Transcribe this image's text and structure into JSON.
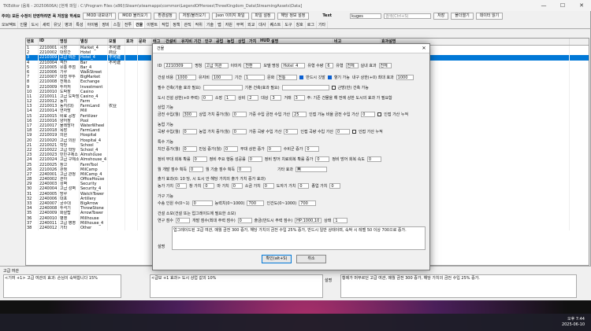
{
  "window": {
    "title": "TKEditor (음복 - 20250606A) [현재 파일 : C:\\Program Files (x86)\\Steam\\steamapps\\common\\LegendOfHeroes\\ThreeKingdom_Data\\StreamingAssets\\Data]",
    "min": "—",
    "max": "☐",
    "close": "✕"
  },
  "toolbar": {
    "items": [
      "주의) 모든 수정이 반영하려면 꼭 저장을 하세요",
      "MOD 내보내기",
      "MOD 불러오기",
      "환경설정",
      "저장/불러오기",
      "Json 이미지 파일",
      "파일 설정",
      "해당 정보 설정"
    ],
    "text_label": "Text",
    "lang": "kuges",
    "search_placeholder": "검색(Ctrl+S)",
    "right_btns": [
      "저장",
      "폴더열기",
      "데이터 읽기",
      "데이터 다시읽기"
    ]
  },
  "tabs": [
    "오브젝트",
    "인물",
    "도시",
    "세력",
    "유닛",
    "병과",
    "특성",
    "아이템",
    "장비",
    "스킬",
    "전투",
    "건물",
    "이벤트",
    "작업",
    "정책",
    "관직",
    "작위",
    "기술",
    "맵",
    "자원",
    "무역",
    "외교",
    "대사",
    "퀘스트",
    "도구",
    "칭호",
    "로그",
    "기타"
  ],
  "grid": {
    "columns": [
      "번호",
      "ID",
      "명칭",
      "별칭",
      "모델",
      "효과",
      "문화",
      "태그",
      "건설비",
      "유지비",
      "기간",
      "인구",
      "공업",
      "농업",
      "상업",
      "가치",
      "HUD",
      "설명",
      "비고",
      "효과설명"
    ],
    "rows": [
      [
        "1",
        "2210001",
        "시장",
        "Market_4",
        "不可建",
        "",
        "",
        "",
        "",
        "",
        "",
        "",
        "",
        "",
        "",
        "",
        "",
        "",
        "",
        "<총 효과 400>"
      ],
      [
        "2",
        "2210002",
        "대장간",
        "Hotel",
        "商业",
        "",
        "",
        "",
        "",
        "",
        "",
        "",
        "",
        "",
        "",
        "",
        "",
        "",
        "",
        ""
      ],
      [
        "3",
        "2210309",
        "고급 여관",
        "Hotel_4",
        "不可建",
        "",
        "",
        "",
        "",
        "",
        "",
        "",
        "",
        "",
        "",
        "",
        "",
        "",
        "",
        "<황혜1기 +1의 효과:15%>"
      ],
      [
        "4",
        "2210004",
        "객잔",
        "Bar",
        "不可建",
        "",
        "",
        "",
        "",
        "",
        "",
        "",
        "",
        "",
        "",
        "",
        "",
        "",
        "",
        ""
      ],
      [
        "5",
        "2210005",
        "유흥 주점",
        "Bar_4",
        "",
        "",
        "",
        "",
        "",
        "",
        "",
        "",
        "",
        "",
        "",
        "",
        "",
        "",
        "",
        "<황혜1기>"
      ],
      [
        "6",
        "2210006",
        "기루",
        "WalkStreet",
        "",
        "",
        "",
        "",
        "",
        "",
        "",
        "",
        "",
        "",
        "",
        "",
        "",
        "",
        "",
        ""
      ],
      [
        "7",
        "2210007",
        "대형 부두",
        "BigMarket",
        "",
        "",
        "",
        "",
        "",
        "",
        "",
        "",
        "",
        "",
        "",
        "",
        "",
        "",
        "",
        "<황혜1기>"
      ],
      [
        "8",
        "2210008",
        "전매소",
        "Exchange",
        "",
        "",
        "",
        "",
        "",
        "",
        "",
        "",
        "",
        "",
        "",
        "",
        "",
        "",
        "",
        "<황혜1기>"
      ],
      [
        "9",
        "2210009",
        "투자처",
        "Investment",
        "",
        "",
        "",
        "",
        "",
        "",
        "",
        "",
        "",
        "",
        "",
        "",
        "",
        "",
        "",
        ""
      ],
      [
        "10",
        "2210010",
        "도박장",
        "Casino",
        "",
        "",
        "",
        "",
        "",
        "",
        "",
        "",
        "",
        "",
        "",
        "",
        "",
        "",
        "",
        ""
      ],
      [
        "11",
        "2210011",
        "고급 도박장",
        "Casino_4",
        "",
        "",
        "",
        "",
        "",
        "",
        "",
        "",
        "",
        "",
        "",
        "",
        "",
        "",
        "",
        "<황혜1기>"
      ],
      [
        "12",
        "2210012",
        "농지",
        "Farm",
        "",
        "",
        "",
        "",
        "",
        "",
        "",
        "",
        "",
        "",
        "",
        "",
        "",
        "",
        "",
        ""
      ],
      [
        "13",
        "2210013",
        "농지(대)",
        "FarmLand",
        "农业",
        "",
        "",
        "",
        "",
        "",
        "",
        "",
        "",
        "",
        "",
        "",
        "",
        "",
        "",
        ""
      ],
      [
        "14",
        "2210014",
        "연자방",
        "Mill",
        "",
        "",
        "",
        "",
        "",
        "",
        "",
        "",
        "",
        "",
        "",
        "",
        "",
        "",
        "",
        ""
      ],
      [
        "15",
        "2210015",
        "비료 공장",
        "Fertilizer",
        "",
        "",
        "",
        "",
        "",
        "",
        "",
        "",
        "",
        "",
        "",
        "",
        "",
        "",
        "",
        "<황혜1기>"
      ],
      [
        "16",
        "2210016",
        "양어장",
        "Pool",
        "",
        "",
        "",
        "",
        "",
        "",
        "",
        "",
        "",
        "",
        "",
        "",
        "",
        "",
        "",
        ""
      ],
      [
        "17",
        "2210017",
        "물레방아",
        "WaterWheel",
        "",
        "",
        "",
        "",
        "",
        "",
        "",
        "",
        "",
        "",
        "",
        "",
        "",
        "",
        "",
        ""
      ],
      [
        "18",
        "2210018",
        "목장",
        "FarmLand",
        "",
        "",
        "",
        "",
        "",
        "",
        "",
        "",
        "",
        "",
        "",
        "",
        "",
        "",
        "",
        ""
      ],
      [
        "19",
        "2210019",
        "의원",
        "Hospital",
        "",
        "",
        "",
        "",
        "",
        "",
        "",
        "",
        "",
        "",
        "",
        "",
        "",
        "",
        "",
        ""
      ],
      [
        "20",
        "2210020",
        "고급 의원",
        "Hospital_4",
        "",
        "",
        "",
        "",
        "",
        "",
        "",
        "",
        "",
        "",
        "",
        "",
        "",
        "",
        "",
        "<황혜1기>"
      ],
      [
        "21",
        "2210021",
        "학당",
        "School",
        "",
        "",
        "",
        "",
        "",
        "",
        "",
        "",
        "",
        "",
        "",
        "",
        "",
        "",
        "",
        ""
      ],
      [
        "22",
        "2210022",
        "고급 학당",
        "School_4",
        "",
        "",
        "",
        "",
        "",
        "",
        "",
        "",
        "",
        "",
        "",
        "",
        "",
        "",
        "",
        ""
      ],
      [
        "23",
        "2210023",
        "빈민구제소",
        "Almshouse",
        "",
        "",
        "",
        "",
        "",
        "",
        "",
        "",
        "",
        "",
        "",
        "",
        "",
        "",
        "",
        ""
      ],
      [
        "24",
        "2210024",
        "고급 구제소",
        "Almshouse_4",
        "",
        "",
        "",
        "",
        "",
        "",
        "",
        "",
        "",
        "",
        "",
        "",
        "",
        "",
        "",
        ""
      ],
      [
        "25",
        "2210025",
        "창고",
        "FarmTool",
        "",
        "",
        "",
        "",
        "",
        "",
        "",
        "",
        "",
        "",
        "",
        "",
        "",
        "",
        "",
        ""
      ],
      [
        "26",
        "2210026",
        "관청",
        "MilCamp",
        "",
        "",
        "",
        "",
        "",
        "",
        "",
        "",
        "",
        "",
        "",
        "",
        "",
        "",
        "",
        ""
      ],
      [
        "27",
        "2240001",
        "고급 관청",
        "MilCamp_4",
        "",
        "",
        "",
        "",
        "",
        "",
        "",
        "",
        "",
        "",
        "",
        "",
        "",
        "",
        "",
        ""
      ],
      [
        "28",
        "2240002",
        "관아",
        "OfficeHouse",
        "",
        "",
        "",
        "",
        "",
        "",
        "",
        "",
        "",
        "",
        "",
        "",
        "",
        "",
        "",
        ""
      ],
      [
        "29",
        "2240003",
        "성벽",
        "Security",
        "",
        "",
        "",
        "",
        "",
        "",
        "",
        "",
        "",
        "",
        "",
        "",
        "",
        "",
        "",
        ""
      ],
      [
        "30",
        "2240004",
        "고급 성벽",
        "Security_4",
        "",
        "",
        "",
        "",
        "",
        "",
        "",
        "",
        "",
        "",
        "",
        "",
        "",
        "",
        "",
        ""
      ],
      [
        "31",
        "2240005",
        "망루",
        "WatchTower",
        "",
        "",
        "",
        "",
        "",
        "",
        "",
        "",
        "",
        "",
        "",
        "",
        "",
        "",
        "",
        ""
      ],
      [
        "32",
        "2240006",
        "대포",
        "Artillery",
        "",
        "",
        "",
        "",
        "",
        "",
        "",
        "",
        "",
        "",
        "",
        "",
        "",
        "",
        "",
        ""
      ],
      [
        "33",
        "2240007",
        "궁수대",
        "BigArrow",
        "",
        "",
        "",
        "",
        "",
        "",
        "",
        "",
        "",
        "",
        "",
        "",
        "",
        "",
        "",
        ""
      ],
      [
        "34",
        "2240008",
        "투석기",
        "ThrowStone",
        "",
        "",
        "",
        "",
        "",
        "",
        "",
        "",
        "",
        "",
        "",
        "",
        "",
        "",
        "",
        ""
      ],
      [
        "35",
        "2240009",
        "화살탑",
        "ArrowTower",
        "",
        "",
        "",
        "",
        "",
        "",
        "",
        "",
        "",
        "",
        "",
        "",
        "",
        "",
        "",
        ""
      ],
      [
        "36",
        "2240010",
        "병영",
        "Millhouse",
        "",
        "",
        "",
        "",
        "",
        "",
        "",
        "",
        "",
        "",
        "",
        "",
        "",
        "",
        "",
        ""
      ],
      [
        "37",
        "2240011",
        "고급 병영",
        "Millhouse_4",
        "",
        "",
        "",
        "",
        "",
        "",
        "",
        "",
        "",
        "",
        "",
        "",
        "",
        "",
        "",
        ""
      ],
      [
        "38",
        "2240012",
        "기타",
        "Other",
        "",
        "",
        "",
        "",
        "",
        "",
        "",
        "",
        "",
        "",
        "",
        "",
        "",
        "",
        "",
        ""
      ]
    ],
    "selected_index": 2
  },
  "bottom": {
    "left_label": "고급 여관",
    "left_text": "<기여 +1> 고급 여관의 효과: 손님이 숙박합니다 15%",
    "mid_text": "<급보 +1 효과> 도시 상업 값의 10%",
    "right_label": "설명",
    "right_text": "황제가 머무르던 고급 여관, 매월 금전 300 증가, 해당 가치의 금전 수입 25% 증가."
  },
  "dialog": {
    "title": "건물",
    "close": "✕",
    "id_label": "ID",
    "id": "2210309",
    "name_label": "명칭",
    "name": "고급 여관",
    "alias_label": "이미지",
    "alias": "전환",
    "model_label": "모델 명칭",
    "model": "Hotel_4",
    "level_label": "유형 수량",
    "level": "6",
    "type_label": "유형",
    "type": "전체",
    "build_label": "실내 효과",
    "build": "전체",
    "r2": {
      "build_cost_label": "건설 비용",
      "build_cost": "1000",
      "upkeep_label": "유지비",
      "upkeep": "100",
      "period_label": "기간",
      "period": "1",
      "culture_label": "문화",
      "culture": "전통",
      "chk1": "반드시 깃발",
      "chk2": "혈기 가능",
      "ai_label": "내구 상한(+0) 최대 효과",
      "ai": "1000"
    },
    "r3": {
      "req_label": "필수 건축(기술 효과 필요)",
      "req": "",
      "base_label": "기본 건축(효과 필요)",
      "base": "",
      "chk": "근방(만) 건축 가능"
    },
    "r4": {
      "a_label": "도시 건설 상한(+0 주력)",
      "a": "0",
      "b_label": "소장",
      "b": "1",
      "c_label": "상비",
      "c": "2",
      "d_label": "대상",
      "d": "3",
      "e_label": "거래",
      "e": "3",
      "note": "주: 기존 건물을 해 전에 상한 도시의 효과 가 필요함"
    },
    "sec_income": "상업 기능",
    "income": {
      "a_label": "금전 수입(월)",
      "a": "300",
      "b_label": "상업 가치 증가(월)",
      "b": "0",
      "c_label": "가중 수입 금전 수입 가산",
      "c": "25",
      "d_label": "인접 가능 비율 금전 수입 가산",
      "d": "0",
      "chk": "인접 가산 누적"
    },
    "sec_food": "농업 기능",
    "food": {
      "a_label": "곡량 수입(월)",
      "a": "0",
      "b_label": "농업 가치 증가(월)",
      "b": "0",
      "c_label": "가중 곡량 수입 가산",
      "c": "0",
      "d_label": "인접 곡량 수입 가산",
      "d": "0",
      "chk": "인접 가산 누적"
    },
    "sec_pop": "특수 기능",
    "pop": {
      "a_label": "치안 증가(월)",
      "a": "0",
      "b_label": "민심 증가(월)",
      "b": "0",
      "c_label": "부대 상한 증가",
      "c": "0",
      "d_label": "수비군 증가",
      "d": "0"
    },
    "pop2": {
      "a_label": "정비 부대 회복 확률",
      "a": "0",
      "b_label": "정비 주요 행동 성공률",
      "b": "0",
      "c_label": "정비 방어 치료회복 확률 증가",
      "c": "0",
      "d_label": "정비 방어 회복 속도",
      "d": "0"
    },
    "pop3": {
      "a_label": "월 개발 점수 획득",
      "a": "0",
      "b_label": "월 기술 점수 획득",
      "b": "0",
      "c_label": "기타 효과",
      "c": "無"
    },
    "sec_near": "출가 효과(0: 10 당, 시 도시 안 해당 가치의 출가 가치 증가 효과)",
    "near": {
      "a_label": "농가 가치",
      "a": "0",
      "b_label": "창 가치",
      "b": "0",
      "c_label": "마 가치",
      "c": "0",
      "d_label": "소금 가치",
      "d": "0",
      "e_label": "도자기 가치",
      "e": "0",
      "f_label": "종업 가치",
      "f": "0"
    },
    "sec_unit": "가구 기능",
    "unit": {
      "a_label": "수송 인원 수(0~1)",
      "a": "0",
      "b_label": "능력치(0~1000)",
      "b": "700",
      "c_label": "인건도(0~1000)",
      "c": "700"
    },
    "sec_special": "건설 소모(건설 또는 업그레이드에 필요한 소모)",
    "special": {
      "a_label": "연구 점수",
      "a": "0",
      "b_label": "개발 점수(최대 주력 점수)",
      "b": "0",
      "c_label": "출금(반드시 주력 점수)",
      "c": "HP:1000,10",
      "d_label": "상태",
      "d": "1"
    },
    "desc_label": "설명",
    "desc": "업그레이드된 고급 여관, 매월 금전 300 증가, 해당 가치의 금전 수입 25% 증가, 반드시 일반 상태이며, 숙박 시 레벨 50 이상 700으로 증가.",
    "ok": "확인(alt+S)",
    "cancel": "취소"
  },
  "taskbar": {
    "time": "오후 7:44",
    "date": "2025-06-10"
  }
}
